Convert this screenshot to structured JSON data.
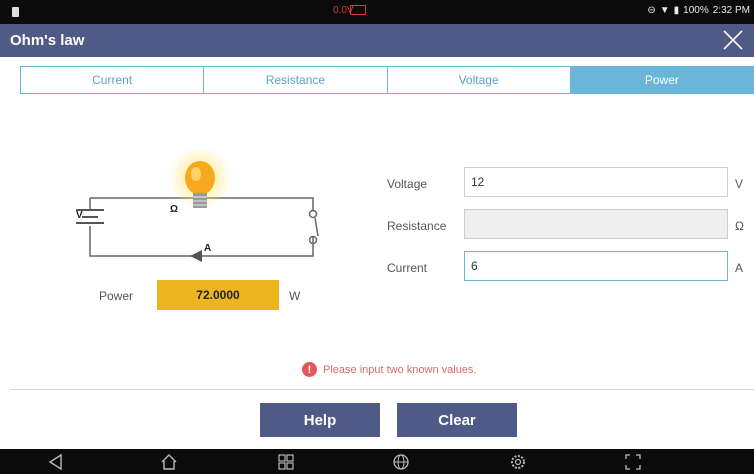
{
  "status_bar": {
    "voltage": "0.0V",
    "battery_percent": "100%",
    "time": "2:32 PM"
  },
  "header": {
    "title": "Ohm's law"
  },
  "tabs": [
    {
      "label": "Current"
    },
    {
      "label": "Resistance"
    },
    {
      "label": "Voltage"
    },
    {
      "label": "Power",
      "active": true
    }
  ],
  "circuit": {
    "voltage_symbol": "V",
    "resistance_symbol": "Ω",
    "current_symbol": "A"
  },
  "result": {
    "label": "Power",
    "value": "72.0000",
    "unit": "W"
  },
  "fields": {
    "voltage": {
      "label": "Voltage",
      "value": "12",
      "unit": "V"
    },
    "resistance": {
      "label": "Resistance",
      "value": "",
      "unit": "Ω"
    },
    "current": {
      "label": "Current",
      "value": "6",
      "unit": "A"
    }
  },
  "message": "Please input two known values.",
  "buttons": {
    "help": "Help",
    "clear": "Clear"
  },
  "colors": {
    "header_bg": "#4f5a86",
    "tab_accent": "#69b6d8",
    "result_bg": "#ecb51f",
    "error": "#e25858"
  },
  "icons": {
    "nav": [
      "back-icon",
      "home-icon",
      "recent-apps-icon",
      "browser-icon",
      "settings-icon",
      "screenshot-icon"
    ]
  }
}
